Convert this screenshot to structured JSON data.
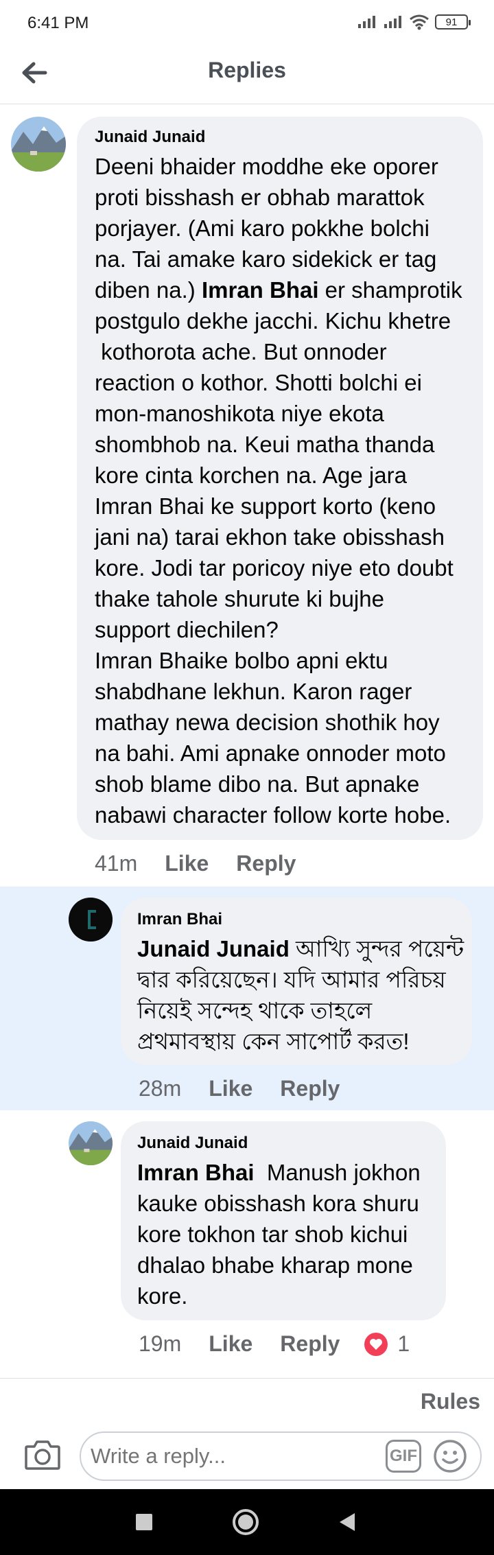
{
  "status_bar": {
    "time": "6:41 PM",
    "battery": "91"
  },
  "app_bar": {
    "title": "Replies"
  },
  "comments": [
    {
      "author": "Junaid Junaid",
      "lines": [
        "Deeni bhaider moddhe eke oporer",
        "proti bisshash er obhab marattok",
        "porjayer. (Ami karo pokkhe bolchi",
        "na. Tai amake karo sidekick er tag",
        "diben na.) |Imran Bhai| er shamprotik",
        "postgulo dekhe jacchi. Kichu khetre",
        " kothorota ache. But onnoder",
        "reaction o kothor. Shotti bolchi ei",
        "mon-manoshikota niye ekota",
        "shombhob na. Keui matha thanda",
        "kore cinta korchen na. Age jara",
        "Imran Bhai ke support korto (keno",
        "jani na) tarai ekhon take obisshash",
        "kore. Jodi tar poricoy niye eto doubt",
        "thake tahole shurute ki bujhe",
        "support diechilen?",
        "Imran Bhaike bolbo apni ektu",
        "shabdhane lekhun. Karon rager",
        "mathay newa decision shothik hoy",
        "na bahi. Ami apnake onnoder moto",
        "shob blame dibo na. But apnake",
        "nabawi character follow korte hobe."
      ],
      "time": "41m",
      "like": "Like",
      "reply": "Reply"
    },
    {
      "author": "Imran Bhai",
      "mention": "Junaid Junaid",
      "lines": [
        " আখ্যি সুন্দর পয়েন্ট",
        "দ্বার করিয়েছেন। যদি আমার পরিচয়",
        "নিয়েই সন্দেহ থাকে তাহলে",
        "প্রথমাবস্থায় কেন সাপোর্ট করত!"
      ],
      "time": "28m",
      "like": "Like",
      "reply": "Reply"
    },
    {
      "author": "Junaid Junaid",
      "mention": "Imran Bhai",
      "lines": [
        "  Manush jokhon",
        "kauke obisshash kora shuru",
        "kore tokhon tar shob kichui",
        "dhalao bhabe kharap mone",
        "kore."
      ],
      "time": "19m",
      "like": "Like",
      "reply": "Reply",
      "reactions": "1"
    }
  ],
  "rules_label": "Rules",
  "composer": {
    "placeholder": "Write a reply...",
    "gif_label": "GIF"
  },
  "icons": {
    "back": "arrow-left-icon",
    "camera": "camera-icon",
    "emoji": "emoji-icon",
    "heart": "heart-reaction-icon"
  },
  "colors": {
    "highlight": "#e7f0fd",
    "bubble": "#eff1f4",
    "heart": "#f33e58"
  }
}
